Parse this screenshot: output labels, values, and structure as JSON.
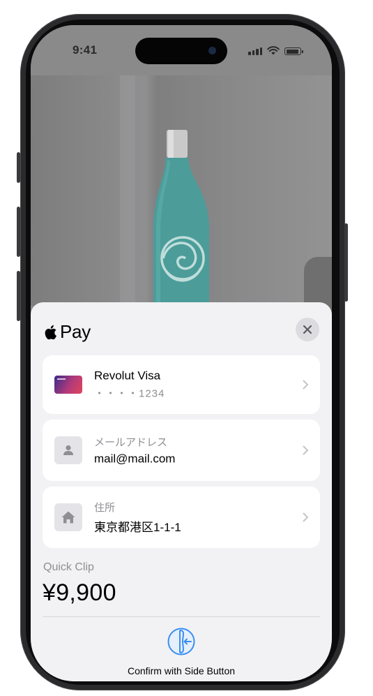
{
  "status_bar": {
    "time": "9:41"
  },
  "sheet": {
    "brand": "Pay",
    "rows": [
      {
        "kind": "card",
        "title": "Revolut Visa",
        "subtitle": "・・・・1234",
        "icon": "card-icon"
      },
      {
        "kind": "email",
        "label": "メールアドレス",
        "value": "mail@mail.com",
        "icon": "person-icon"
      },
      {
        "kind": "address",
        "label": "住所",
        "value": "東京都港区1-1-1",
        "icon": "house-icon"
      }
    ],
    "merchant": "Quick Clip",
    "price": "¥9,900",
    "confirm_label": "Confirm with Side Button"
  },
  "colors": {
    "accent": "#3a8ef0",
    "sheet_bg": "#f2f2f4"
  }
}
